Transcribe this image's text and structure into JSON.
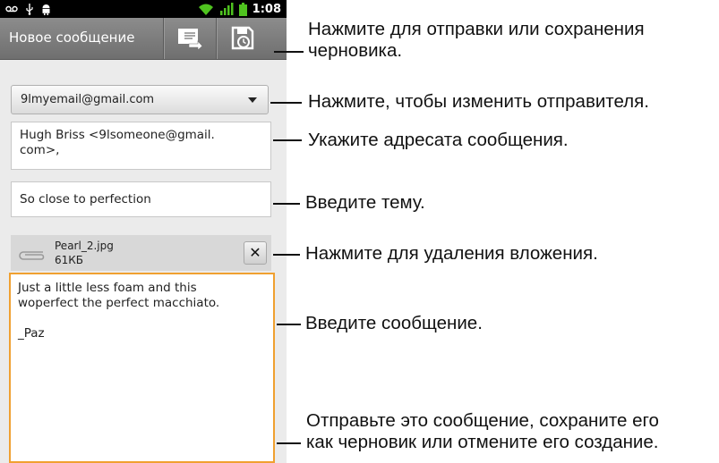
{
  "status_bar": {
    "time": "1:08"
  },
  "title_bar": {
    "title": "Новое сообщение"
  },
  "compose": {
    "from_value": "9lmyemail@gmail.com",
    "to_line1": "Hugh Briss <9lsomeone@gmail.",
    "to_line2": "com>,",
    "subject_value": "So close to perfection",
    "attachment_name": "Pearl_2.jpg",
    "attachment_size": "61КБ",
    "attachment_remove_glyph": "✕",
    "body_text": "Just a little less foam and this\nwoperfect the perfect macchiato.\n\n_Paz"
  },
  "callouts": {
    "send_save_line1": "Нажмите для отправки или сохранения",
    "send_save_line2": "черновика.",
    "change_sender": "Нажмите, чтобы изменить отправителя.",
    "recipient": "Укажите адресата сообщения.",
    "subject": "Введите тему.",
    "remove_attachment": "Нажмите для удаления вложения.",
    "message": "Введите сообщение.",
    "actions_line1": "Отправьте это сообщение, сохраните его",
    "actions_line2": "как черновик или отмените его создание."
  },
  "colors": {
    "titlebar": "#7c7c7c",
    "body_border": "#f0a030",
    "screen_bg": "#ebebeb"
  }
}
